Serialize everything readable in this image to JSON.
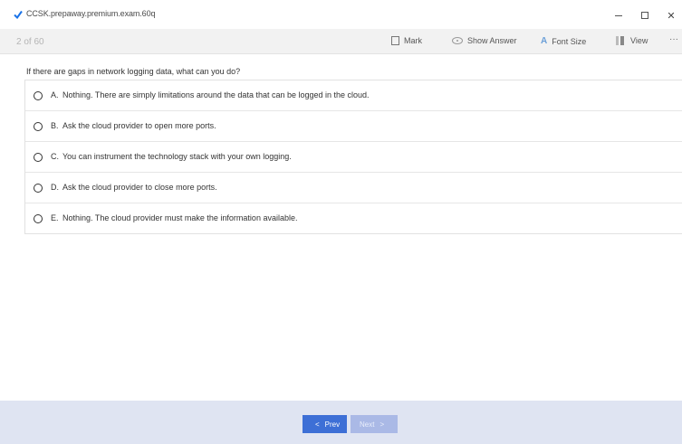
{
  "window": {
    "title": "CCSK.prepaway.premium.exam.60q",
    "minimize": "–",
    "close": "✕"
  },
  "toolbar": {
    "counter": "2 of 60",
    "mark": "Mark",
    "show_answer": "Show Answer",
    "font_size": "Font Size",
    "font_icon": "A",
    "view": "View",
    "more": "···"
  },
  "question": {
    "text": "If there are gaps in network logging data, what can you do?",
    "options": [
      {
        "letter": "A.",
        "text": "Nothing. There are simply limitations around the data that can be logged in the cloud."
      },
      {
        "letter": "B.",
        "text": "Ask the cloud provider to open more ports."
      },
      {
        "letter": "C.",
        "text": "You can instrument the technology stack with your own logging."
      },
      {
        "letter": "D.",
        "text": "Ask the cloud provider to close more ports."
      },
      {
        "letter": "E.",
        "text": "Nothing. The cloud provider must make the information available."
      }
    ]
  },
  "nav": {
    "prev_label": "Prev",
    "next_label": "Next",
    "prev_icon": "<",
    "next_icon": ">"
  },
  "colors": {
    "accent": "#3d6fd6",
    "disabled": "#aab9e6",
    "bottom_bar": "#dfe4f2",
    "check": "#1a73e8"
  }
}
